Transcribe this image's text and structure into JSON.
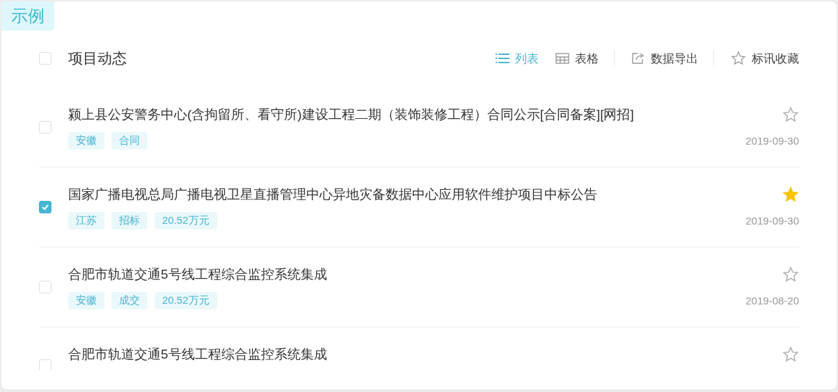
{
  "badge": "示例",
  "header": {
    "title": "项目动态",
    "checked": false
  },
  "view_options": [
    {
      "label": "列表",
      "selected": true,
      "kind": "list"
    },
    {
      "label": "表格",
      "selected": false,
      "kind": "table"
    }
  ],
  "actions": [
    {
      "label": "数据导出",
      "kind": "export"
    },
    {
      "label": "标讯收藏",
      "kind": "favorite"
    }
  ],
  "items": [
    {
      "title": "颍上县公安警务中心(含拘留所、看守所)建设工程二期（装饰装修工程）合同公示[合同备案][网招]",
      "checked": false,
      "starred": false,
      "tags": [
        "安徽",
        "合同"
      ],
      "date": "2019-09-30"
    },
    {
      "title": "国家广播电视总局广播电视卫星直播管理中心异地灾备数据中心应用软件维护项目中标公告",
      "checked": true,
      "starred": true,
      "tags": [
        "江苏",
        "招标",
        "20.52万元"
      ],
      "date": "2019-09-30"
    },
    {
      "title": "合肥市轨道交通5号线工程综合监控系统集成",
      "checked": false,
      "starred": false,
      "tags": [
        "安徽",
        "成交",
        "20.52万元"
      ],
      "date": "2019-08-20"
    },
    {
      "title": "合肥市轨道交通5号线工程综合监控系统集成",
      "checked": false,
      "starred": false
    }
  ]
}
